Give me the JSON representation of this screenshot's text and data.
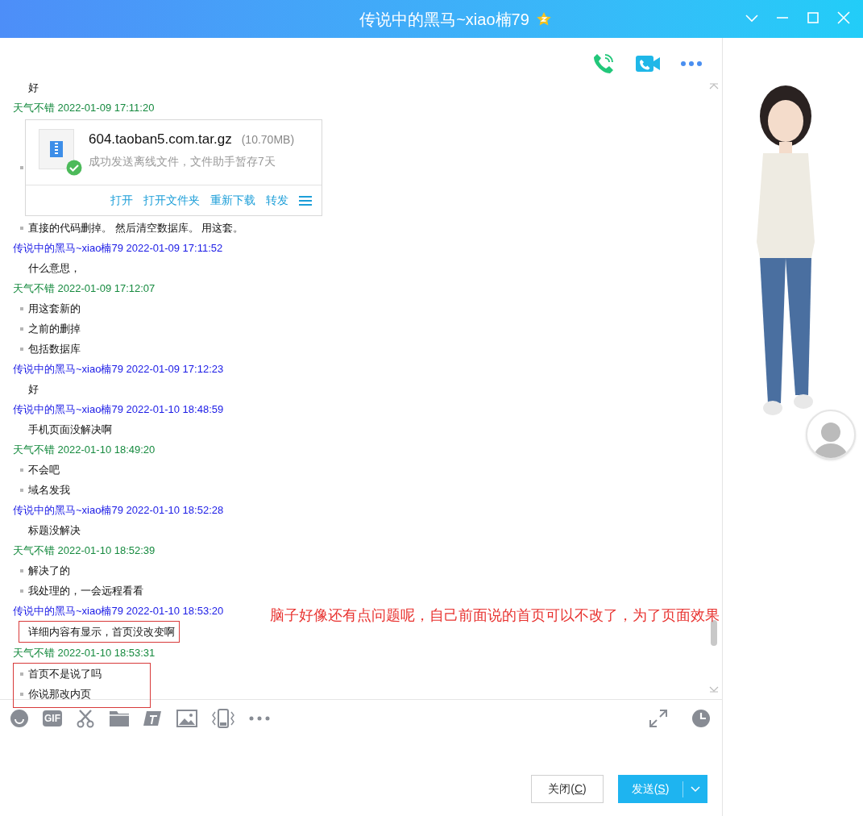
{
  "window": {
    "title": "传说中的黑马~xiao楠79"
  },
  "messages": [
    {
      "kind": "other",
      "highlighted": false,
      "items": [
        {
          "kind": "text",
          "text": "好"
        }
      ]
    },
    {
      "kind": "self",
      "highlighted": false,
      "header": "天气不错 2022-01-09 17:11:20",
      "items": [
        {
          "kind": "file",
          "name": "604.taoban5.com.tar.gz",
          "size": "(10.70MB)",
          "status": "成功发送离线文件，文件助手暂存7天",
          "actions": [
            "打开",
            "打开文件夹",
            "重新下载",
            "转发"
          ]
        },
        {
          "kind": "text",
          "text": "直接的代码删掉。 然后清空数据库。 用这套。"
        }
      ]
    },
    {
      "kind": "other",
      "highlighted": false,
      "header": "传说中的黑马~xiao楠79 2022-01-09 17:11:52",
      "items": [
        {
          "kind": "text",
          "text": "什么意思，"
        }
      ]
    },
    {
      "kind": "self",
      "highlighted": false,
      "header": "天气不错 2022-01-09 17:12:07",
      "items": [
        {
          "kind": "text",
          "text": "用这套新的"
        },
        {
          "kind": "text",
          "text": "之前的删掉"
        },
        {
          "kind": "text",
          "text": "包括数据库"
        }
      ]
    },
    {
      "kind": "other",
      "highlighted": false,
      "header": "传说中的黑马~xiao楠79 2022-01-09 17:12:23",
      "items": [
        {
          "kind": "text",
          "text": "好"
        }
      ]
    },
    {
      "kind": "other",
      "highlighted": false,
      "header": "传说中的黑马~xiao楠79 2022-01-10 18:48:59",
      "items": [
        {
          "kind": "text",
          "text": "手机页面没解决啊"
        }
      ]
    },
    {
      "kind": "self",
      "highlighted": false,
      "header": "天气不错 2022-01-10 18:49:20",
      "items": [
        {
          "kind": "text",
          "text": "不会吧"
        },
        {
          "kind": "text",
          "text": "域名发我"
        }
      ]
    },
    {
      "kind": "other",
      "highlighted": false,
      "header": "传说中的黑马~xiao楠79 2022-01-10 18:52:28",
      "items": [
        {
          "kind": "text",
          "text": "标题没解决"
        }
      ]
    },
    {
      "kind": "self",
      "highlighted": false,
      "header": "天气不错 2022-01-10 18:52:39",
      "items": [
        {
          "kind": "text",
          "text": "解决了的"
        },
        {
          "kind": "text",
          "text": "我处理的，一会远程看看"
        }
      ]
    },
    {
      "kind": "other",
      "highlighted": true,
      "header": "传说中的黑马~xiao楠79 2022-01-10 18:53:20",
      "items": [
        {
          "kind": "text",
          "text": "详细内容有显示，首页没改变啊"
        }
      ]
    },
    {
      "kind": "self",
      "highlighted": true,
      "header": "天气不错 2022-01-10 18:53:31",
      "items": [
        {
          "kind": "text",
          "text": "首页不是说了吗"
        },
        {
          "kind": "text",
          "text": "你说那改内页"
        }
      ]
    }
  ],
  "annotation": {
    "text": "脑子好像还有点问题呢，自己前面说的首页可以不改了，为了页面效果"
  },
  "toolbar": {
    "gif_label": "GIF"
  },
  "buttons": {
    "close": [
      "关闭(",
      "C",
      ")"
    ],
    "send": [
      "发送(",
      "S",
      ")"
    ]
  }
}
